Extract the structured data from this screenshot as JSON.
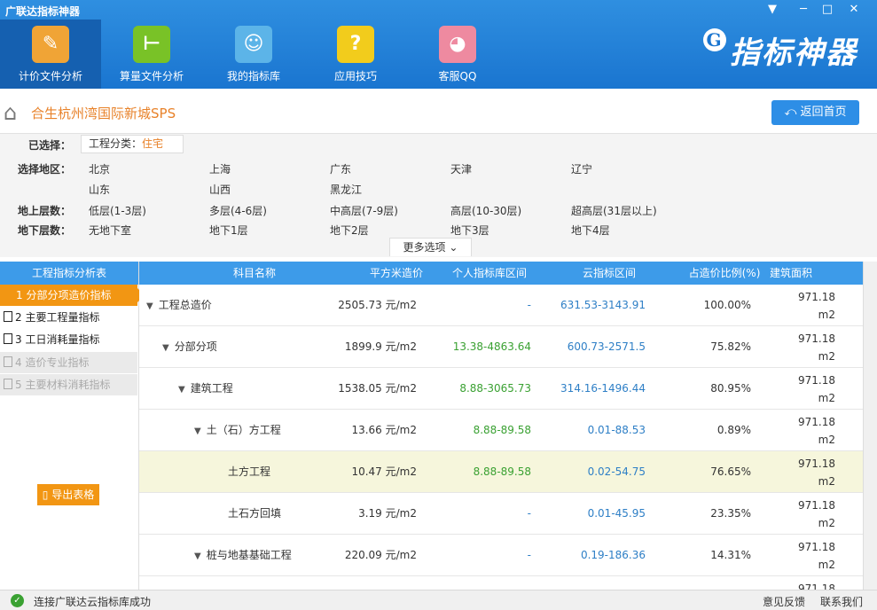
{
  "app": {
    "title": "广联达指标神器",
    "brand": "指标神器",
    "brand_logo": "G"
  },
  "window_controls": {
    "help": "▼",
    "minimize": "─",
    "maximize": "□",
    "close": "✕"
  },
  "toolbar": [
    {
      "label": "计价文件分析",
      "icon": "edit-document-icon",
      "color": "#f0a436",
      "glyph": "✎"
    },
    {
      "label": "算量文件分析",
      "icon": "ruler-icon",
      "color": "#79c227",
      "glyph": "⊢"
    },
    {
      "label": "我的指标库",
      "icon": "user-chart-icon",
      "color": "#5cb4e8",
      "glyph": "☺"
    },
    {
      "label": "应用技巧",
      "icon": "question-icon",
      "color": "#f2cc1c",
      "glyph": "?"
    },
    {
      "label": "客服QQ",
      "icon": "qq-icon",
      "color": "#ee8aa0",
      "glyph": "◕"
    }
  ],
  "project": {
    "title": "合生杭州湾国际新城SPS",
    "back_label": "返回首页"
  },
  "filters": {
    "selected_label": "已选择：",
    "selected_tag_key": "工程分类：",
    "selected_tag_value": "住宅",
    "region_label": "选择地区：",
    "regions": [
      "北京",
      "上海",
      "广东",
      "天津",
      "辽宁",
      "山东",
      "山西",
      "黑龙江"
    ],
    "above_label": "地上层数：",
    "above_floors": [
      "低层(1-3层)",
      "多层(4-6层)",
      "中高层(7-9层)",
      "高层(10-30层)",
      "超高层(31层以上)"
    ],
    "below_label": "地下层数：",
    "below_floors": [
      "无地下室",
      "地下1层",
      "地下2层",
      "地下3层",
      "地下4层"
    ],
    "more_label": "更多选项"
  },
  "left_panel": {
    "title": "工程指标分析表",
    "items": [
      {
        "label": "1 分部分项造价指标",
        "state": "active"
      },
      {
        "label": "2 主要工程量指标",
        "state": "normal"
      },
      {
        "label": "3 工日消耗量指标",
        "state": "normal"
      },
      {
        "label": "4 造价专业指标",
        "state": "disabled"
      },
      {
        "label": "5 主要材料消耗指标",
        "state": "disabled"
      }
    ],
    "export_label": "导出表格"
  },
  "table": {
    "headers": [
      "科目名称",
      "平方米造价",
      "个人指标库区间",
      "云指标区间",
      "占造价比例(%)",
      "建筑面积"
    ],
    "rows": [
      {
        "name": "工程总造价",
        "level": 0,
        "expand": true,
        "price": "2505.73 元/m2",
        "personal": "-",
        "cloud": "631.53-3143.91",
        "ratio": "100.00%",
        "area": "971.18",
        "unit": "m2"
      },
      {
        "name": "分部分项",
        "level": 1,
        "expand": true,
        "price": "1899.9 元/m2",
        "personal": "13.38-4863.64",
        "cloud": "600.73-2571.5",
        "ratio": "75.82%",
        "area": "971.18",
        "unit": "m2"
      },
      {
        "name": "建筑工程",
        "level": 2,
        "expand": true,
        "price": "1538.05 元/m2",
        "personal": "8.88-3065.73",
        "cloud": "314.16-1496.44",
        "ratio": "80.95%",
        "area": "971.18",
        "unit": "m2"
      },
      {
        "name": "土（石）方工程",
        "level": 3,
        "expand": true,
        "price": "13.66 元/m2",
        "personal": "8.88-89.58",
        "cloud": "0.01-88.53",
        "ratio": "0.89%",
        "area": "971.18",
        "unit": "m2"
      },
      {
        "name": "土方工程",
        "level": 4,
        "expand": false,
        "price": "10.47 元/m2",
        "personal": "8.88-89.58",
        "cloud": "0.02-54.75",
        "ratio": "76.65%",
        "area": "971.18",
        "unit": "m2"
      },
      {
        "name": "土石方回填",
        "level": 4,
        "expand": false,
        "price": "3.19 元/m2",
        "personal": "-",
        "cloud": "0.01-45.95",
        "ratio": "23.35%",
        "area": "971.18",
        "unit": "m2"
      },
      {
        "name": "桩与地基基础工程",
        "level": 3,
        "expand": true,
        "price": "220.09 元/m2",
        "personal": "-",
        "cloud": "0.19-186.36",
        "ratio": "14.31%",
        "area": "971.18",
        "unit": "m2"
      },
      {
        "name": "",
        "level": 3,
        "expand": false,
        "price": "",
        "personal": "",
        "cloud": "",
        "ratio": "",
        "area": "971.18",
        "unit": ""
      }
    ]
  },
  "status": {
    "message": "连接广联达云指标库成功",
    "feedback": "意见反馈",
    "contact": "联系我们"
  }
}
